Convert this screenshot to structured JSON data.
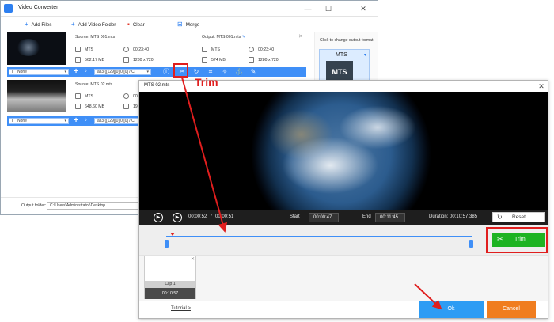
{
  "main_window": {
    "title": "Video Converter",
    "controls": {
      "minimize": "—",
      "maximize": "☐",
      "close": "✕"
    },
    "toolbar": {
      "add_files": "Add Files",
      "add_video_folder": "Add Video Folder",
      "clear": "Clear",
      "merge": "Merge"
    },
    "files": [
      {
        "source": "Source: MTS 001.mts",
        "output": "Output: MTS 001.mts",
        "src_format": "MTS",
        "src_duration": "00:23:40",
        "src_size": "562.17 MB",
        "src_resolution": "1280 x 720",
        "out_format": "MTS",
        "out_duration": "00:23:40",
        "out_size": "574 MB",
        "out_resolution": "1280 x 720",
        "subtitle": "None",
        "audio": "ac3 ([129][0][0][0] / C"
      },
      {
        "source": "Source: MTS 02.mts",
        "src_format": "MTS",
        "src_duration": "00:23:40",
        "src_size": "648.60 MB",
        "src_resolution": "192",
        "subtitle": "None",
        "audio": "ac3 ([129][0][0][0] / C"
      }
    ],
    "sidebar": {
      "hint": "Click to change output format",
      "format_label": "MTS",
      "format_icon_text": "MTS"
    },
    "output_folder": {
      "label": "Output folder:",
      "path": "C:\\Users\\Administrator\\Desktop"
    }
  },
  "trim_dialog": {
    "title": "MTS 02.mts",
    "close": "✕",
    "playback": {
      "current": "00:00:52",
      "separator": "/",
      "total": "00:00:51"
    },
    "start_label": "Start",
    "start_value": "00:00:47",
    "end_label": "End",
    "end_value": "00:11:45",
    "duration_label": "Duration: 00:10:57.385",
    "reset_label": "Reset",
    "trim_label": "Trim",
    "timeline": {
      "start_fraction": 0.0,
      "end_fraction": 1.0,
      "playhead_fraction": 0.02
    },
    "clip": {
      "name": "Clip 1",
      "duration": "00:10:57"
    },
    "tutorial": "Tutorial >",
    "ok": "Ok",
    "cancel": "Cancel"
  },
  "annotation": {
    "label": "Trim",
    "color": "#e01e1e"
  },
  "colors": {
    "accent": "#3f8ff7",
    "trim_green": "#1db322",
    "ok_blue": "#2d9cf4",
    "cancel_orange": "#f07d1f"
  }
}
